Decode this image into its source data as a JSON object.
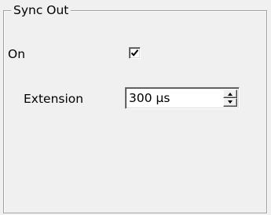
{
  "group": {
    "title": "Sync Out"
  },
  "on": {
    "label": "On",
    "checked": true
  },
  "extension": {
    "label": "Extension",
    "value": "300 µs"
  },
  "icons": {
    "check": "checkmark-icon",
    "spin_up": "chevron-up-icon",
    "spin_down": "chevron-down-icon"
  }
}
